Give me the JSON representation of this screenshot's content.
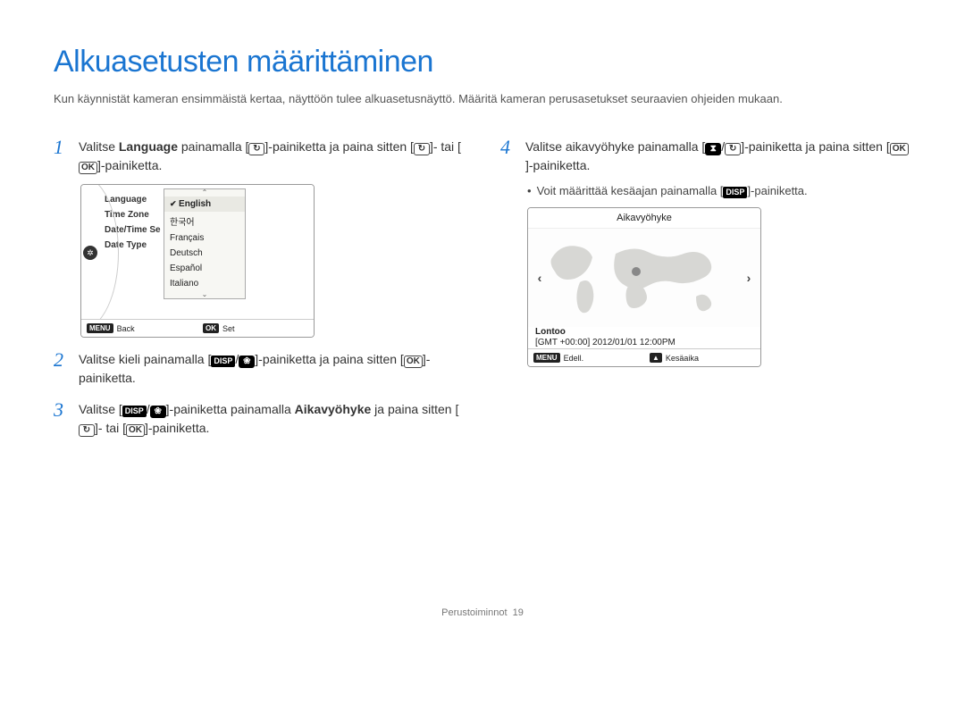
{
  "title": "Alkuasetusten määrittäminen",
  "intro": "Kun käynnistät kameran ensimmäistä kertaa, näyttöön tulee alkuasetusnäyttö. Määritä kameran perusasetukset seuraavien ohjeiden mukaan.",
  "steps": {
    "s1": {
      "num": "1",
      "t1": "Valitse ",
      "bold": "Language",
      "t2": " painamalla [",
      "t3": "]-painiketta ja paina sitten [",
      "t4": "]- tai [",
      "t5": "]-painiketta."
    },
    "s2": {
      "num": "2",
      "t1": "Valitse kieli painamalla [",
      "t2": "]-painiketta ja paina sitten [",
      "t3": "]-painiketta."
    },
    "s3": {
      "num": "3",
      "t1": "Valitse [",
      "t2": "]-painiketta painamalla ",
      "bold": "Aikavyöhyke",
      "t3": " ja paina sitten [",
      "t4": "]- tai [",
      "t5": "]-painiketta."
    },
    "s4": {
      "num": "4",
      "t1": "Valitse aikavyöhyke painamalla [",
      "t2": "]-painiketta ja paina sitten [",
      "t3": "]-painiketta."
    },
    "s4sub": {
      "t1": "Voit määrittää kesäajan painamalla [",
      "t2": "]-painiketta."
    }
  },
  "icons": {
    "timer_glyph": "↻",
    "ok": "OK",
    "disp": "DISP",
    "macro_glyph": "❀",
    "flash_glyph": "⧗",
    "slash": "/",
    "menu": "MENU",
    "up_tri": "▲"
  },
  "lcd1": {
    "menu": [
      "Language",
      "Time Zone",
      "Date/Time Se",
      "Date Type"
    ],
    "options": [
      "English",
      "한국어",
      "Français",
      "Deutsch",
      "Español",
      "Italiano"
    ],
    "selected": "English",
    "arrow_up": "⌃",
    "arrow_dn": "⌄",
    "foot_back_key": "MENU",
    "foot_back": "Back",
    "foot_set_key": "OK",
    "foot_set": "Set"
  },
  "lcd2": {
    "title": "Aikavyöhyke",
    "left": "‹",
    "right": "›",
    "city": "Lontoo",
    "meta": "[GMT +00:00]   2012/01/01   12:00PM",
    "foot_menu_key": "MENU",
    "foot_prev": "Edell.",
    "foot_dst_key": "▲",
    "foot_dst": "Kesäaika"
  },
  "footer": {
    "section": "Perustoiminnot",
    "page": "19"
  }
}
